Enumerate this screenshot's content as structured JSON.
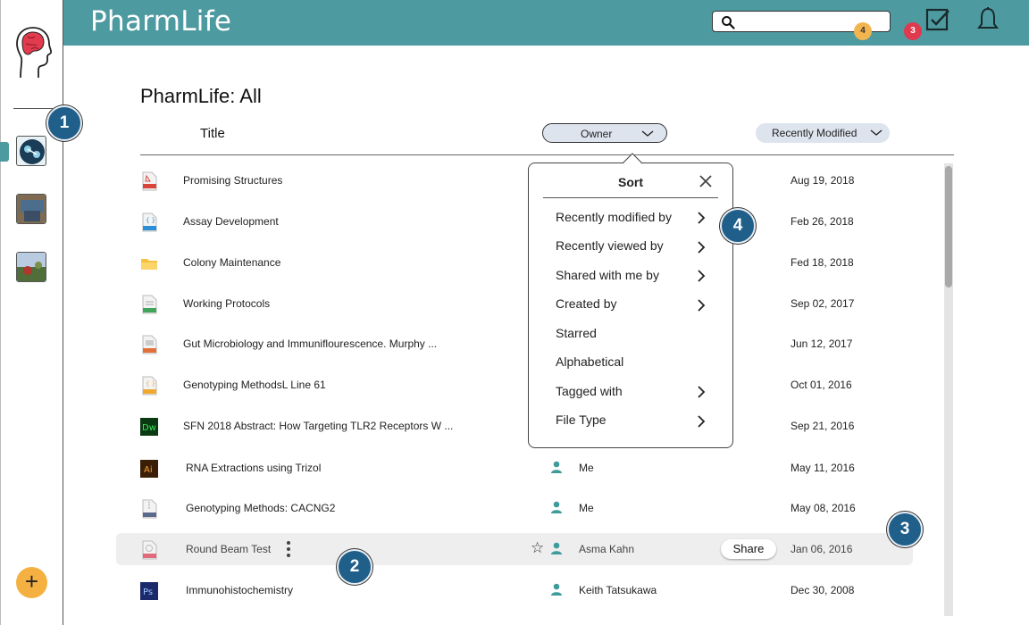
{
  "header": {
    "app_title": "PharmLife",
    "search_placeholder": "",
    "tasks_count": "4",
    "notifications_count": "3"
  },
  "rail": {
    "add_label": "+"
  },
  "main": {
    "page_title": "PharmLife: All",
    "columns": {
      "title": "Title",
      "owner": "Owner",
      "sort": "Recently Modified"
    },
    "rows": [
      {
        "title": "Promising Structures",
        "owner": "",
        "date": "Aug 19, 2018",
        "icon": "pdf-icon"
      },
      {
        "title": "Assay Development",
        "owner": "",
        "date": "Feb 26, 2018",
        "icon": "css-file-icon"
      },
      {
        "title": "Colony Maintenance",
        "owner": "",
        "date": "Fed 18, 2018",
        "icon": "folder-icon"
      },
      {
        "title": "Working Protocols",
        "owner": "",
        "date": "Sep 02, 2017",
        "icon": "xls-file-icon"
      },
      {
        "title": "Gut Microbiology and Immuniflourescence. Murphy ...",
        "owner": "",
        "date": "Jun 12, 2017",
        "icon": "ppt-file-icon"
      },
      {
        "title": "Genotyping MethodsL Line 61",
        "owner": "",
        "date": "Oct 01, 2016",
        "icon": "js-file-icon"
      },
      {
        "title": "SFN 2018 Abstract: How Targeting TLR2 Receptors W ...",
        "owner": "",
        "date": "Sep 21, 2016",
        "icon": "dreamweaver-icon"
      },
      {
        "title": "RNA Extractions using Trizol",
        "owner": "Me",
        "date": "May 11, 2016",
        "icon": "illustrator-icon"
      },
      {
        "title": "Genotyping Methods: CACNG2",
        "owner": "Me",
        "date": "May 08, 2016",
        "icon": "zip-file-icon"
      },
      {
        "title": "Round Beam Test",
        "owner": "Asma Kahn",
        "date": "Jan 06, 2016",
        "icon": "mp4-file-icon",
        "share_label": "Share"
      },
      {
        "title": "Immunohistochemistry",
        "owner": "Keith Tatsukawa",
        "date": "Dec 30, 2008",
        "icon": "photoshop-icon"
      }
    ]
  },
  "sort_popup": {
    "title": "Sort",
    "items": [
      "Recently modified by",
      "Recently viewed by",
      "Shared with me by",
      "Created by",
      "Starred",
      "Alphabetical",
      "Tagged with",
      "File Type"
    ]
  },
  "callouts": [
    "1",
    "2",
    "3",
    "4"
  ],
  "colors": {
    "header": "#4d9aa0",
    "accent_orange": "#f4b040",
    "badge_red": "#e03a4f",
    "callout": "#1f5f8a",
    "user_icon": "#3f9b9b"
  }
}
